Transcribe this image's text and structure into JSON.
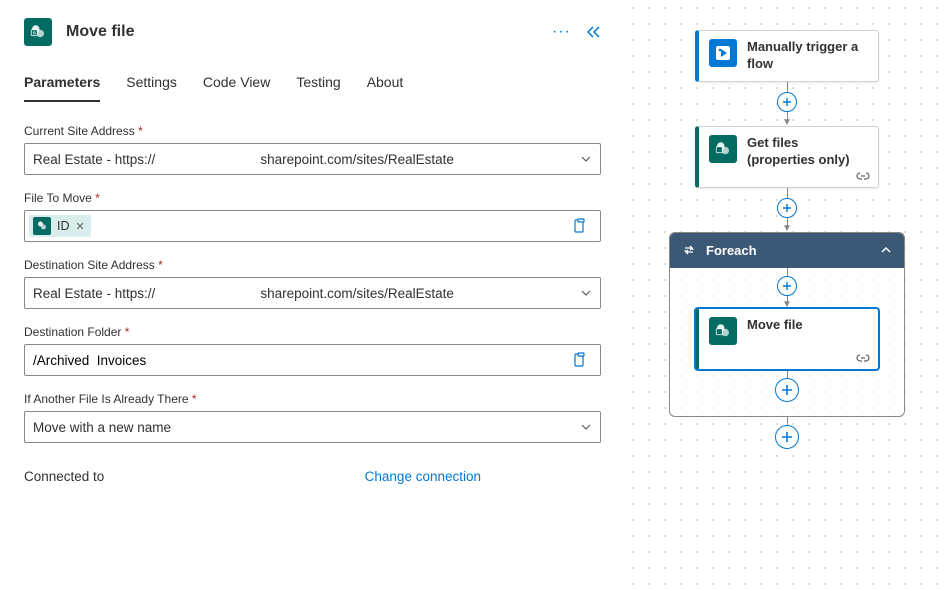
{
  "panel": {
    "title": "Move file",
    "tabs": {
      "parameters": "Parameters",
      "settings": "Settings",
      "codeview": "Code View",
      "testing": "Testing",
      "about": "About"
    },
    "fields": {
      "current_site": {
        "label": "Current Site Address",
        "value": "Real Estate - https://                            sharepoint.com/sites/RealEstate"
      },
      "file_to_move": {
        "label": "File To Move",
        "token": "ID"
      },
      "dest_site": {
        "label": "Destination Site Address",
        "value": "Real Estate - https://                            sharepoint.com/sites/RealEstate"
      },
      "dest_folder": {
        "label": "Destination Folder",
        "value": "/Archived  Invoices"
      },
      "if_exists": {
        "label": "If Another File Is Already There",
        "value": "Move with a new name"
      }
    },
    "connection": {
      "label": "Connected to",
      "change": "Change connection"
    }
  },
  "canvas": {
    "trigger": "Manually trigger a flow",
    "getfiles": "Get files (properties only)",
    "foreach": "Foreach",
    "movefile": "Move file"
  }
}
